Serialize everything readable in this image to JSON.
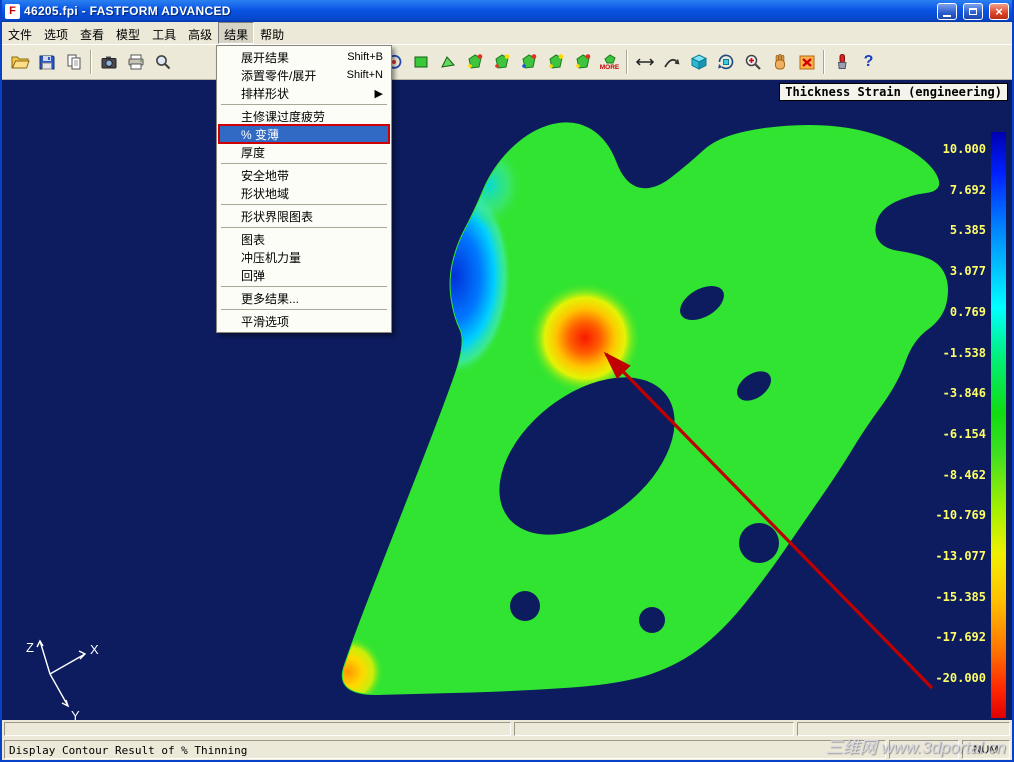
{
  "window": {
    "icon_letter": "F",
    "title": "46205.fpi - FASTFORM ADVANCED",
    "close_glyph": "×"
  },
  "menubar": {
    "items": [
      {
        "label": "文件"
      },
      {
        "label": "选项"
      },
      {
        "label": "查看"
      },
      {
        "label": "模型"
      },
      {
        "label": "工具"
      },
      {
        "label": "高级"
      },
      {
        "label": "结果",
        "active": true
      },
      {
        "label": "帮助"
      }
    ]
  },
  "results_menu": {
    "items": [
      {
        "label": "展开结果",
        "shortcut": "Shift+B"
      },
      {
        "label": "添置零件/展开",
        "shortcut": "Shift+N"
      },
      {
        "label": "排样形状",
        "submenu": true
      },
      {
        "separator": true
      },
      {
        "label": "主修课过度疲劳"
      },
      {
        "label": "% 变薄",
        "selected": true
      },
      {
        "label": "厚度"
      },
      {
        "separator": true
      },
      {
        "label": "安全地带"
      },
      {
        "label": "形状地域"
      },
      {
        "separator": true
      },
      {
        "label": "形状界限图表"
      },
      {
        "separator": true
      },
      {
        "label": "图表"
      },
      {
        "label": "冲压机力量"
      },
      {
        "label": "回弹"
      },
      {
        "separator": true
      },
      {
        "label": "更多结果..."
      },
      {
        "separator": true
      },
      {
        "label": "平滑选项"
      }
    ]
  },
  "toolbar": {
    "icons": [
      {
        "name": "open"
      },
      {
        "name": "save"
      },
      {
        "name": "copy"
      },
      {
        "name": "camera"
      },
      {
        "name": "print"
      },
      {
        "name": "zoom"
      },
      {
        "name": "rotate-view"
      },
      {
        "name": "shaded-view"
      },
      {
        "name": "area-plot"
      },
      {
        "name": "result-display-1"
      },
      {
        "name": "result-display-2"
      },
      {
        "name": "result-display-3"
      },
      {
        "name": "result-display-4"
      },
      {
        "name": "result-display-5"
      },
      {
        "name": "more-results",
        "label": "MORE"
      },
      {
        "name": "measure"
      },
      {
        "name": "flatten-curve"
      },
      {
        "name": "cube-3d"
      },
      {
        "name": "rotate-3d"
      },
      {
        "name": "zoom-in"
      },
      {
        "name": "pan-hand"
      },
      {
        "name": "close-result"
      },
      {
        "name": "marker"
      },
      {
        "name": "help",
        "glyph": "?"
      }
    ]
  },
  "viewport": {
    "legend_title": "Thickness Strain (engineering)",
    "colorbar_values": [
      "10.000",
      "7.692",
      "5.385",
      "3.077",
      "0.769",
      "-1.538",
      "-3.846",
      "-6.154",
      "-8.462",
      "-10.769",
      "-13.077",
      "-15.385",
      "-17.692",
      "-20.000"
    ],
    "axis": {
      "x": "X",
      "y": "Y",
      "z": "Z"
    }
  },
  "statusbar": {
    "message": "Display Contour Result of % Thinning",
    "num": "NUM"
  },
  "watermark": "三维网 www.3dportal.cn",
  "colors": {
    "viewport_bg": "#0c1c5e",
    "part_green": "#31e431",
    "legend_text": "#ffff66",
    "annotation_arrow": "#c00000",
    "selected_menu_highlight": "#316ac5",
    "selection_outline": "#d00000"
  }
}
